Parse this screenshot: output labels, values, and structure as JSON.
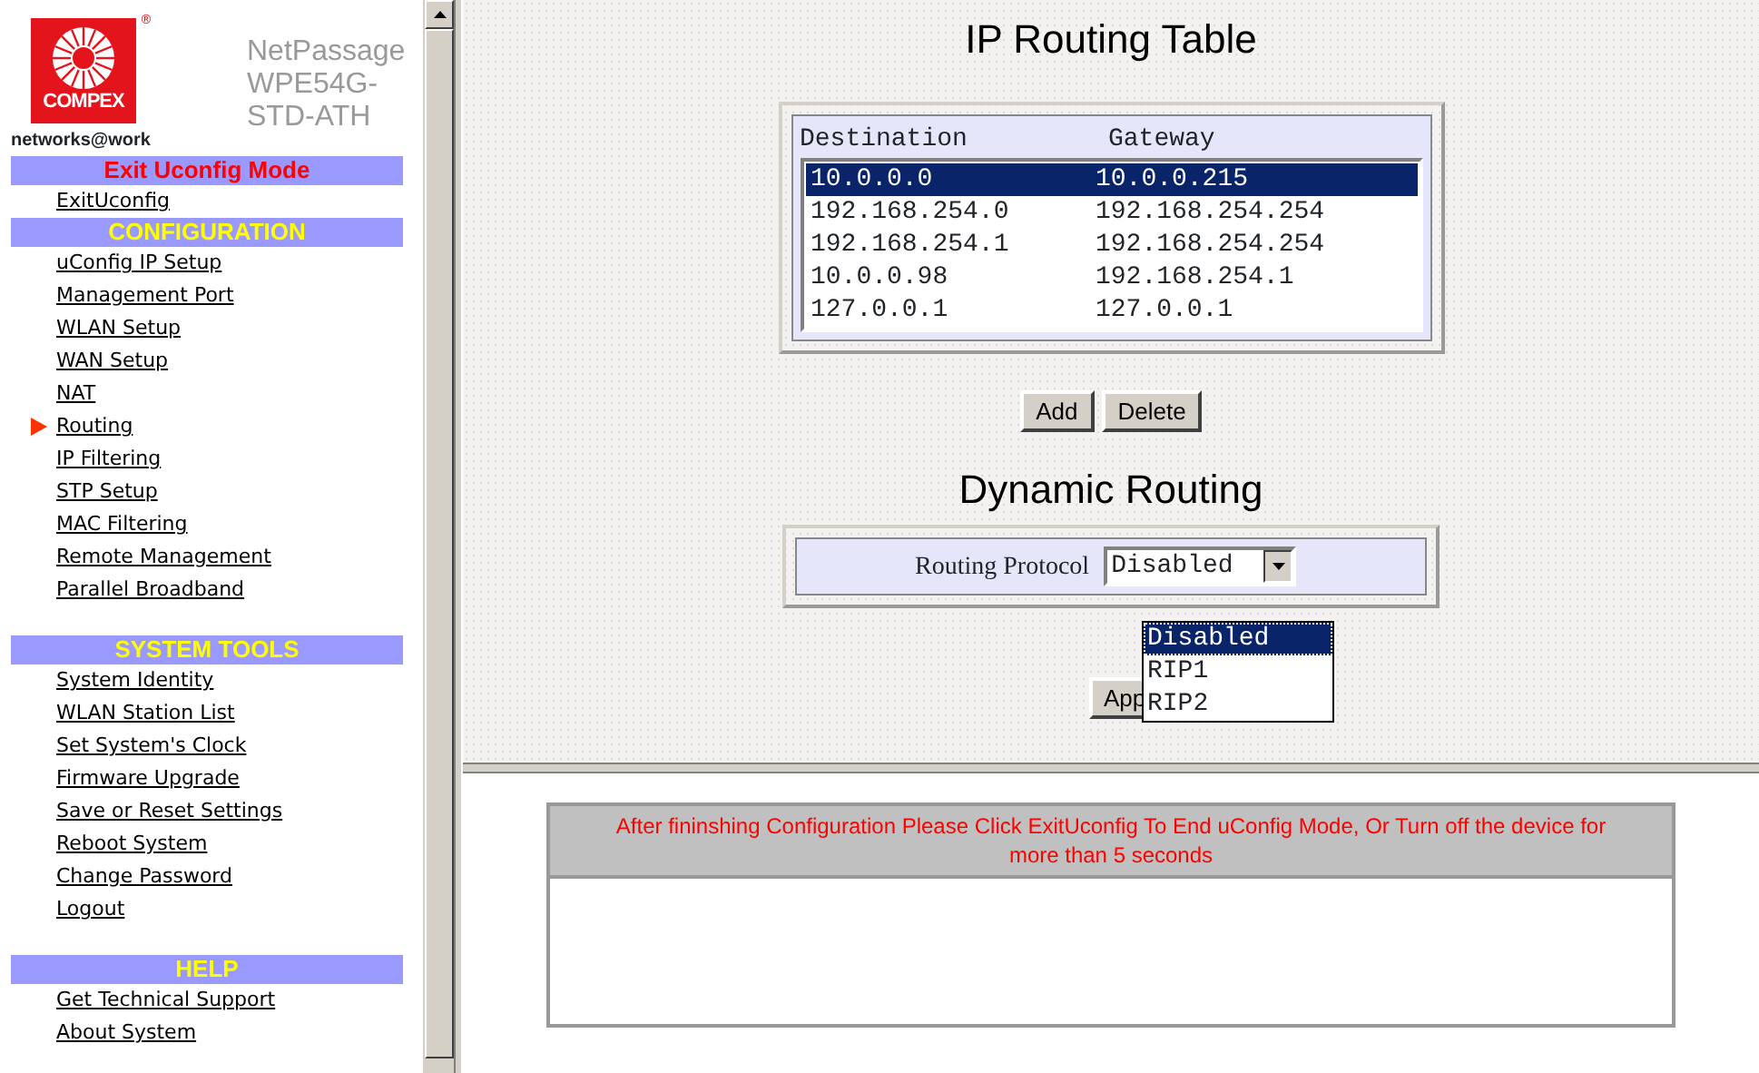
{
  "logo": {
    "text": "COMPEX",
    "mark": "®",
    "tagline": "networks@work"
  },
  "product": {
    "lines": [
      "NetPassage",
      "WPE54G-",
      "STD-ATH"
    ]
  },
  "sidebar": {
    "sections": [
      {
        "title": "Exit Uconfig Mode",
        "kind": "exit",
        "items": [
          {
            "label": "ExitUconfig",
            "selected": false
          }
        ]
      },
      {
        "title": "CONFIGURATION",
        "kind": "group",
        "items": [
          {
            "label": "uConfig IP Setup",
            "selected": false
          },
          {
            "label": "Management Port",
            "selected": false
          },
          {
            "label": "WLAN Setup",
            "selected": false
          },
          {
            "label": "WAN Setup",
            "selected": false
          },
          {
            "label": "NAT",
            "selected": false
          },
          {
            "label": "Routing",
            "selected": true
          },
          {
            "label": "IP Filtering",
            "selected": false
          },
          {
            "label": "STP Setup",
            "selected": false
          },
          {
            "label": "MAC Filtering",
            "selected": false
          },
          {
            "label": "Remote Management",
            "selected": false
          },
          {
            "label": "Parallel Broadband",
            "selected": false
          }
        ]
      },
      {
        "title": "SYSTEM TOOLS",
        "kind": "group",
        "items": [
          {
            "label": "System Identity",
            "selected": false
          },
          {
            "label": "WLAN Station List",
            "selected": false
          },
          {
            "label": "Set System's Clock",
            "selected": false
          },
          {
            "label": "Firmware Upgrade",
            "selected": false
          },
          {
            "label": "Save or Reset Settings",
            "selected": false
          },
          {
            "label": "Reboot System",
            "selected": false
          },
          {
            "label": "Change Password",
            "selected": false
          },
          {
            "label": "Logout",
            "selected": false
          }
        ]
      },
      {
        "title": "HELP",
        "kind": "group",
        "items": [
          {
            "label": "Get Technical Support",
            "selected": false
          },
          {
            "label": "About System",
            "selected": false
          }
        ]
      }
    ]
  },
  "routing_table": {
    "title": "IP Routing Table",
    "columns": [
      "Destination",
      "Gateway"
    ],
    "rows": [
      {
        "cells": [
          "10.0.0.0",
          "10.0.0.215"
        ],
        "selected": true
      },
      {
        "cells": [
          "192.168.254.0",
          "192.168.254.254"
        ],
        "selected": false
      },
      {
        "cells": [
          "192.168.254.1",
          "192.168.254.254"
        ],
        "selected": false
      },
      {
        "cells": [
          "10.0.0.98",
          "192.168.254.1"
        ],
        "selected": false
      },
      {
        "cells": [
          "127.0.0.1",
          "127.0.0.1"
        ],
        "selected": false
      }
    ]
  },
  "buttons": [
    "Add",
    "Delete"
  ],
  "dynamic_routing": {
    "title": "Dynamic Routing",
    "label": "Routing Protocol",
    "value": "Disabled",
    "expanded": true,
    "options": [
      {
        "label": "Disabled",
        "selected": true
      },
      {
        "label": "RIP1",
        "selected": false
      },
      {
        "label": "RIP2",
        "selected": false
      }
    ],
    "apply_button": "App"
  },
  "notice": {
    "text": "After fininshing Configuration Please Click ExitUconfig To End uConfig Mode, Or Turn off the device for more than 5 seconds"
  }
}
